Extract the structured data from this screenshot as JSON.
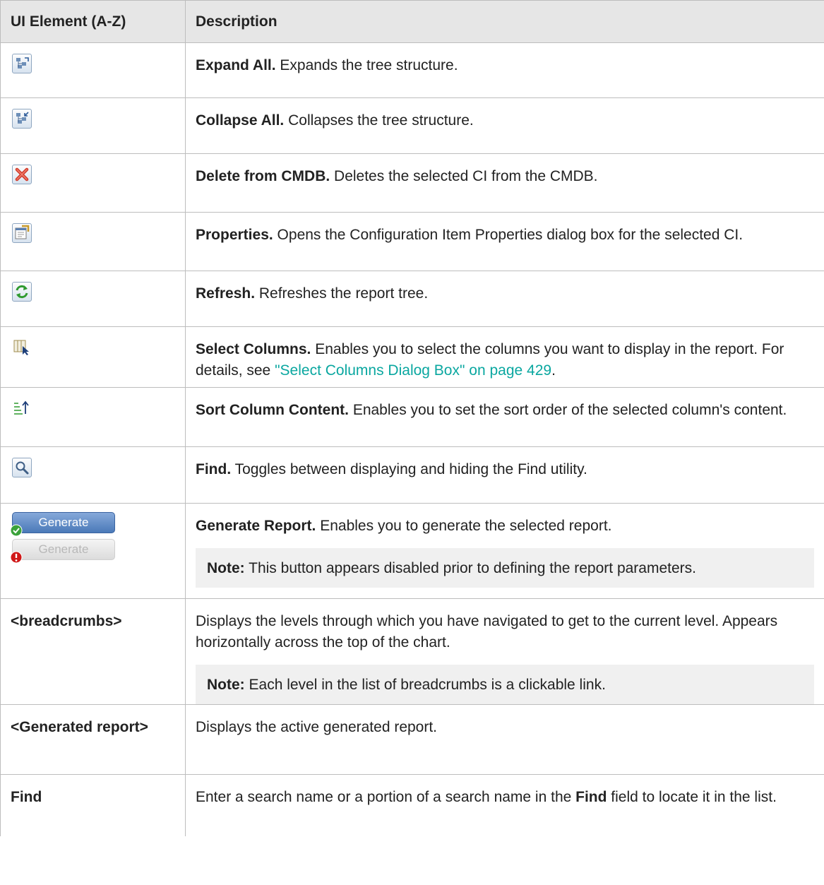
{
  "header": {
    "col1": "UI Element (A-Z)",
    "col2": "Description"
  },
  "rows": [
    {
      "icon": "expand-all-icon",
      "title": "Expand All.",
      "text": " Expands the tree structure."
    },
    {
      "icon": "collapse-all-icon",
      "title": "Collapse All.",
      "text": " Collapses the tree structure."
    },
    {
      "icon": "delete-icon",
      "title": "Delete from CMDB.",
      "text": " Deletes the selected CI from the CMDB."
    },
    {
      "icon": "properties-icon",
      "title": "Properties.",
      "text": " Opens the Configuration Item Properties dialog box for the selected CI."
    },
    {
      "icon": "refresh-icon",
      "title": "Refresh.",
      "text": " Refreshes the report tree."
    },
    {
      "icon": "select-columns-icon",
      "title": "Select Columns.",
      "text": " Enables you to select the columns you want to display in the report. For details, see ",
      "link": "\"Select Columns Dialog Box\" on page 429",
      "after": "."
    },
    {
      "icon": "sort-column-icon",
      "title": "Sort Column Content.",
      "text": " Enables you to set the sort order of the selected column's content."
    },
    {
      "icon": "find-icon",
      "title": "Find.",
      "text": " Toggles between displaying and hiding the Find utility."
    },
    {
      "icon": "generate-buttons",
      "generate_label": "Generate",
      "generate_disabled_label": "Generate",
      "title": "Generate Report.",
      "text": " Enables you to generate the selected report.",
      "note_label": "Note:",
      "note_text": " This button appears disabled prior to defining the report parameters."
    },
    {
      "label": "<breadcrumbs>",
      "text": "Displays the levels through which you have navigated to get to the current level. Appears horizontally across the top of the chart.",
      "note_label": "Note:",
      "note_text": " Each level in the list of breadcrumbs is a clickable link."
    },
    {
      "label": "<Generated report>",
      "text": "Displays the active generated report."
    },
    {
      "label": "Find",
      "text_before": "Enter a search name or a portion of a search name in the ",
      "bold": "Find",
      "text_after": " field to locate it in the list."
    }
  ],
  "colors": {
    "link": "#0aa7a0",
    "header_bg": "#e6e6e6",
    "note_bg": "#f0f0f0",
    "border": "#bdbdbd"
  }
}
